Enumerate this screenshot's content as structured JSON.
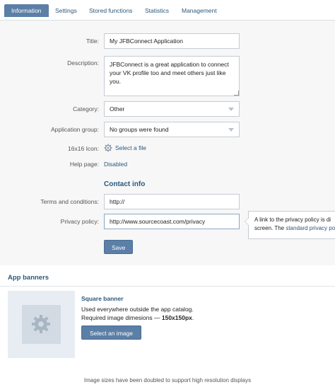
{
  "tabs": [
    {
      "label": "Information",
      "active": true
    },
    {
      "label": "Settings"
    },
    {
      "label": "Stored functions"
    },
    {
      "label": "Statistics"
    },
    {
      "label": "Management"
    }
  ],
  "form": {
    "title_label": "Title:",
    "title_value": "My JFBConnect Application",
    "description_label": "Description:",
    "description_value": "JFBConnect is a great application to connect your VK profile too and meet others just like you.",
    "category_label": "Category:",
    "category_value": "Other",
    "group_label": "Application group:",
    "group_value": "No groups were found",
    "icon_label": "16x16 Icon:",
    "icon_link": "Select a file",
    "help_label": "Help page:",
    "help_value": "Disabled",
    "contact_title": "Contact info",
    "terms_label": "Terms and conditions:",
    "terms_value": "http://",
    "privacy_label": "Privacy policy:",
    "privacy_value": "http://www.sourcecoast.com/privacy",
    "save_label": "Save"
  },
  "tooltip": {
    "line1": "A link to the privacy policy is di",
    "line2_prefix": "screen. The ",
    "line2_link": "standard privacy po"
  },
  "banners": {
    "title": "App banners",
    "square_title": "Square banner",
    "square_desc": "Used everywhere outside the app catalog.",
    "square_req_prefix": "Required image dimesions — ",
    "square_req_size": "150x150px",
    "square_req_suffix": ".",
    "select_label": "Select an image",
    "footer_note": "Image sizes have been doubled to support high resolution displays"
  },
  "colors": {
    "accent": "#5b7fa6",
    "link": "#2b587a"
  }
}
